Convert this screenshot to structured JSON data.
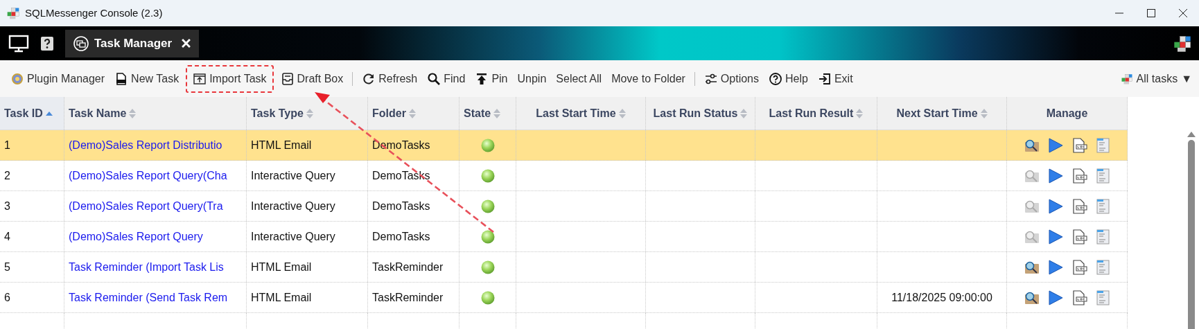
{
  "window": {
    "title": "SQLMessenger Console (2.3)"
  },
  "tabs": [
    {
      "label": "Task Manager",
      "selected": true
    }
  ],
  "toolbar": {
    "items": [
      {
        "kind": "button",
        "label": "Plugin Manager",
        "highlighted": false
      },
      {
        "kind": "button",
        "label": "New Task",
        "highlighted": false
      },
      {
        "kind": "button",
        "label": "Import Task",
        "highlighted": true
      },
      {
        "kind": "button",
        "label": "Draft Box",
        "highlighted": false
      },
      {
        "kind": "separator"
      },
      {
        "kind": "button",
        "label": "Refresh",
        "highlighted": false
      },
      {
        "kind": "button",
        "label": "Find",
        "highlighted": false
      },
      {
        "kind": "button",
        "label": "Pin",
        "highlighted": false
      },
      {
        "kind": "button",
        "label": "Unpin",
        "highlighted": false
      },
      {
        "kind": "button",
        "label": "Select All",
        "highlighted": false
      },
      {
        "kind": "button",
        "label": "Move to Folder",
        "highlighted": false
      },
      {
        "kind": "separator"
      },
      {
        "kind": "button",
        "label": "Options",
        "highlighted": false
      },
      {
        "kind": "button",
        "label": "Help",
        "highlighted": false
      },
      {
        "kind": "button",
        "label": "Exit",
        "highlighted": false
      }
    ],
    "filter": {
      "label": "All tasks",
      "caret": "▼"
    }
  },
  "table": {
    "columns": [
      {
        "label": "Task ID",
        "sortable": true,
        "sorted_ascending": true
      },
      {
        "label": "Task Name",
        "sortable": true,
        "sorted_ascending": false
      },
      {
        "label": "Task Type",
        "sortable": true,
        "sorted_ascending": false
      },
      {
        "label": "Folder",
        "sortable": true,
        "sorted_ascending": false
      },
      {
        "label": "State",
        "sortable": true,
        "sorted_ascending": false
      },
      {
        "label": "Last Start Time",
        "sortable": true,
        "sorted_ascending": false
      },
      {
        "label": "Last Run Status",
        "sortable": true,
        "sorted_ascending": false
      },
      {
        "label": "Last Run Result",
        "sortable": true,
        "sorted_ascending": false
      },
      {
        "label": "Next Start Time",
        "sortable": true,
        "sorted_ascending": false
      },
      {
        "label": "Manage",
        "sortable": false
      }
    ],
    "rows": [
      {
        "id": "1",
        "name": "(Demo)Sales Report Distributio",
        "type": "HTML Email",
        "folder": "DemoTasks",
        "selected": true,
        "view_enabled": true
      },
      {
        "id": "2",
        "name": "(Demo)Sales Report Query(Cha",
        "type": "Interactive Query",
        "folder": "DemoTasks",
        "selected": false,
        "view_enabled": false
      },
      {
        "id": "3",
        "name": "(Demo)Sales Report Query(Tra",
        "type": "Interactive Query",
        "folder": "DemoTasks",
        "selected": false,
        "view_enabled": false
      },
      {
        "id": "4",
        "name": "(Demo)Sales Report Query",
        "type": "Interactive Query",
        "folder": "DemoTasks",
        "selected": false,
        "view_enabled": false
      },
      {
        "id": "5",
        "name": "Task Reminder (Import Task Lis",
        "type": "HTML Email",
        "folder": "TaskReminder",
        "selected": false,
        "view_enabled": true
      },
      {
        "id": "6",
        "name": "Task Reminder (Send Task Rem",
        "type": "HTML Email",
        "folder": "TaskReminder",
        "next_start": "11/18/2025 09:00:00",
        "selected": false,
        "view_enabled": true
      }
    ]
  }
}
